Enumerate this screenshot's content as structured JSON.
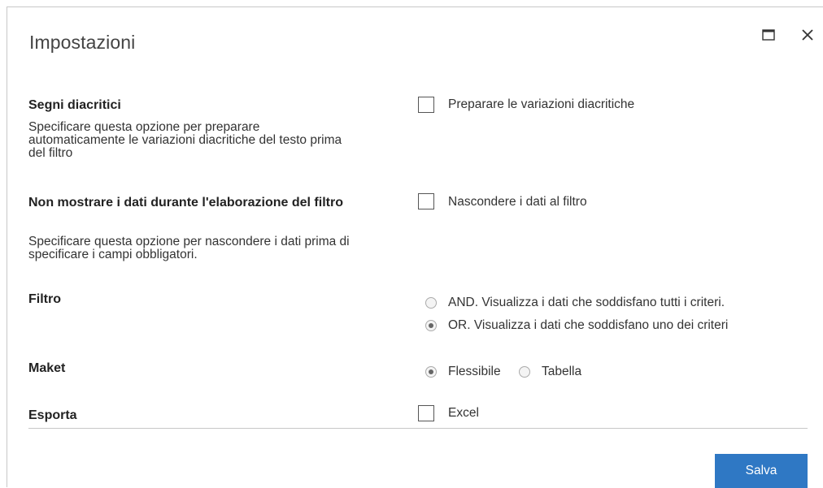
{
  "dialog": {
    "title": "Impostazioni",
    "maximize_icon": "maximize-icon",
    "close_icon": "close-icon"
  },
  "settings": {
    "diacritics": {
      "title": "Segni diacritici",
      "description": "Specificare questa opzione per preparare automaticamente le variazioni diacritiche del testo prima del filtro",
      "option_label": "Preparare le variazioni diacritiche",
      "checked": false
    },
    "hide_data": {
      "title": "Non mostrare i dati durante l'elaborazione del filtro",
      "description": "Specificare questa opzione per nascondere i dati prima di specificare i campi obbligatori.",
      "option_label": "Nascondere i dati al filtro",
      "checked": false
    },
    "filter": {
      "title": "Filtro",
      "options": [
        {
          "label": "AND. Visualizza i dati che soddisfano tutti i criteri.",
          "selected": false
        },
        {
          "label": "OR. Visualizza i dati che soddisfano uno dei criteri",
          "selected": true
        }
      ]
    },
    "layout": {
      "title": "Maket",
      "options": [
        {
          "label": "Flessibile",
          "selected": true
        },
        {
          "label": "Tabella",
          "selected": false
        }
      ]
    },
    "export": {
      "title": "Esporta",
      "option_label": "Excel",
      "checked": false
    }
  },
  "footer": {
    "save_label": "Salva"
  },
  "colors": {
    "accent": "#2f78c4"
  }
}
